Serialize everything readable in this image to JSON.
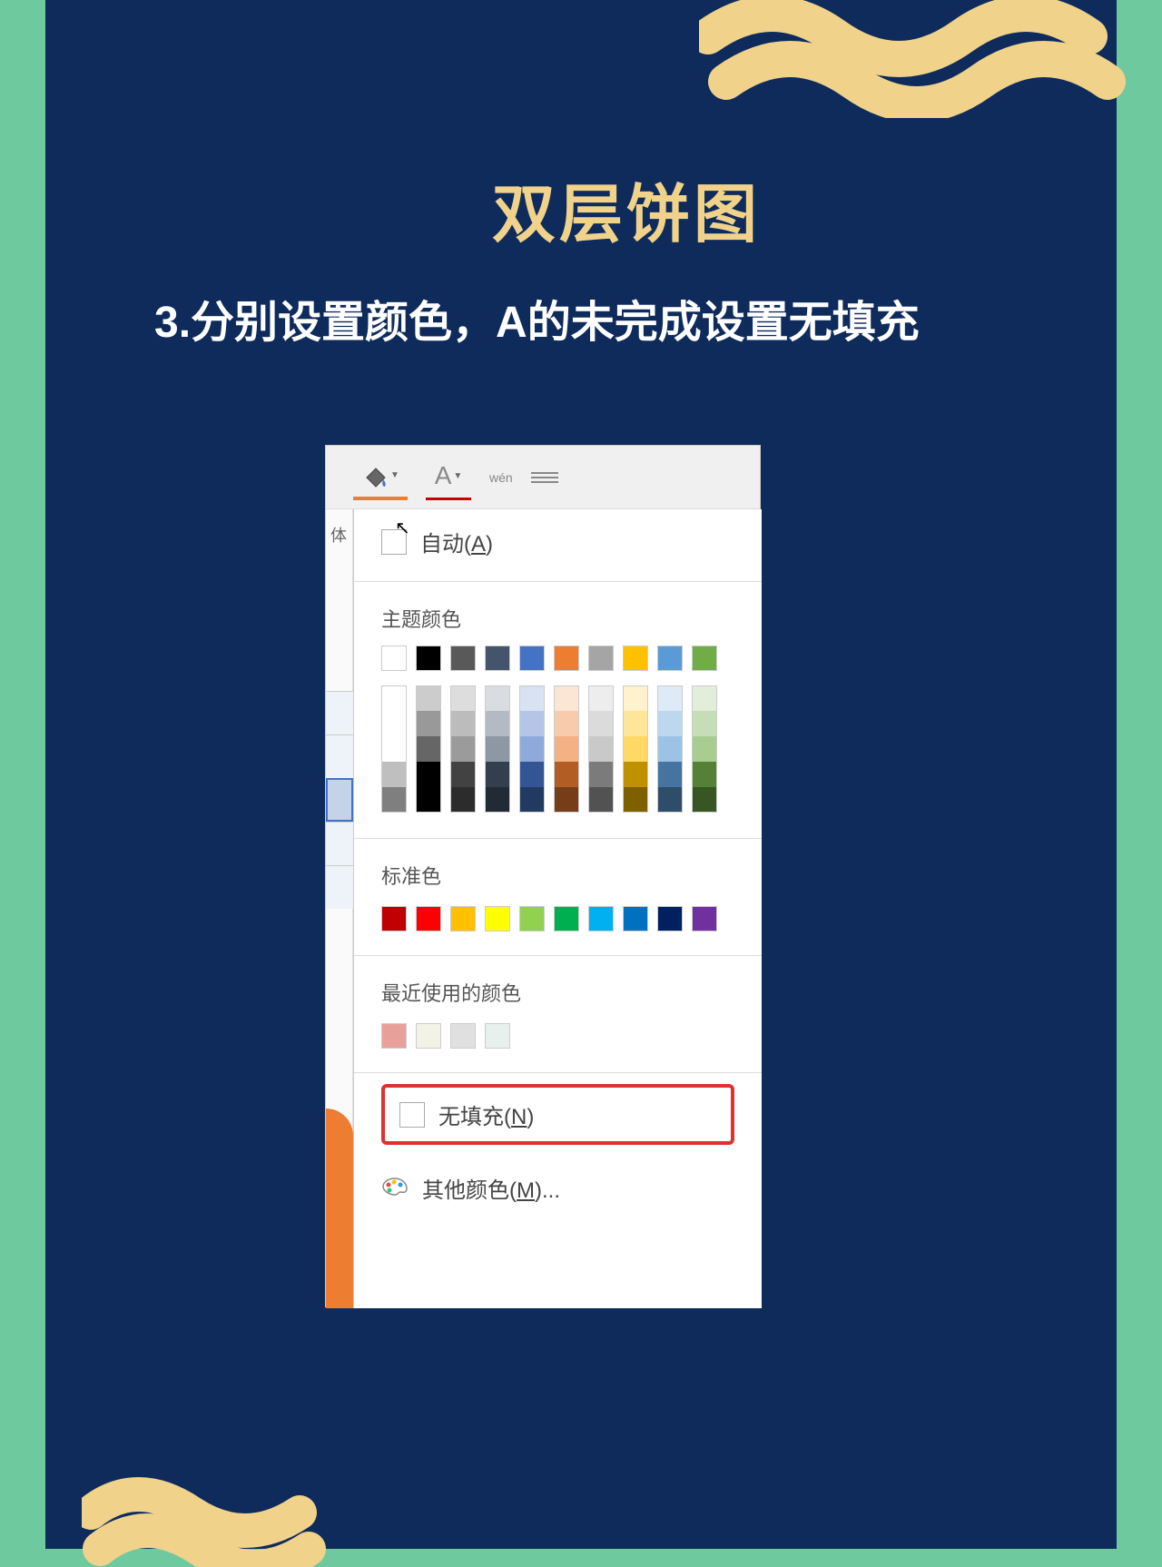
{
  "page": {
    "title": "双层饼图",
    "instruction": "3.分别设置颜色，A的未完成设置无填充"
  },
  "toolbar": {
    "font_letter": "A",
    "wen_label": "wén",
    "ti_label": "体"
  },
  "color_picker": {
    "auto_label": "自动(A)",
    "theme_label": "主题颜色",
    "theme_colors": [
      "#ffffff",
      "#000000",
      "#595959",
      "#44546a",
      "#4472c4",
      "#ed7d31",
      "#a5a5a5",
      "#ffc000",
      "#5b9bd5",
      "#70ad47"
    ],
    "standard_label": "标准色",
    "standard_colors": [
      "#c00000",
      "#ff0000",
      "#ffc000",
      "#ffff00",
      "#92d050",
      "#00b050",
      "#00b0f0",
      "#0070c0",
      "#002060",
      "#7030a0"
    ],
    "recent_label": "最近使用的颜色",
    "recent_colors": [
      "#e8a09a",
      "#f2f2e6",
      "#e0e0e0",
      "#e8f0ee"
    ],
    "no_fill_label": "无填充(N)",
    "more_colors_label": "其他颜色(M)..."
  }
}
